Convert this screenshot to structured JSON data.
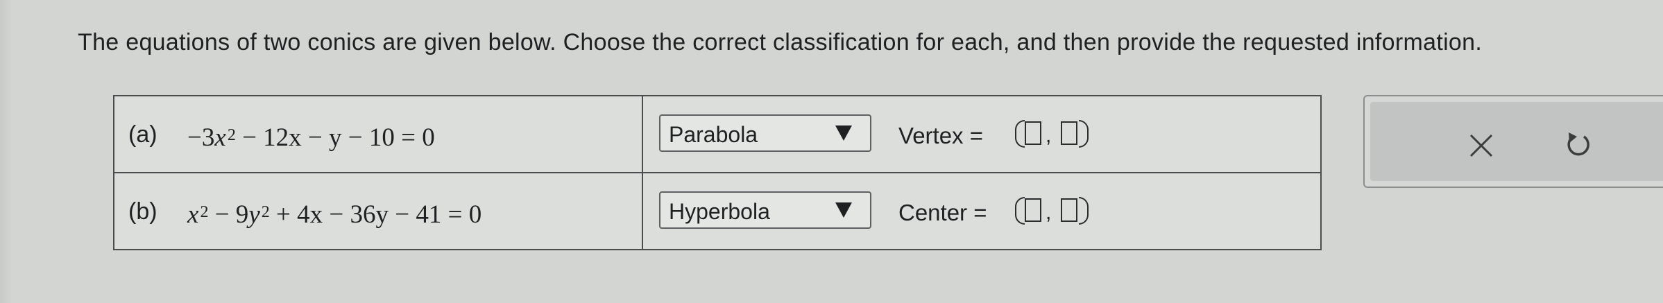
{
  "prompt": "The equations of two conics are given below. Choose the correct classification for each, and then provide the requested information.",
  "rows": [
    {
      "part": "(a)",
      "equation": {
        "lead": "−3",
        "var1": "x",
        "exp1": "2",
        "rest": " − 12x − y − 10 = 0"
      },
      "classification": "Parabola",
      "field_label": "Vertex ="
    },
    {
      "part": "(b)",
      "equation": {
        "var1": "x",
        "exp1": "2",
        "mid": " − 9",
        "var2": "y",
        "exp2": "2",
        "rest": " + 4x − 36y − 41 = 0"
      },
      "classification": "Hyperbola",
      "field_label": "Center ="
    }
  ],
  "pair_separator": ",",
  "tools": {
    "clear_icon": "close-icon",
    "undo_icon": "undo-icon"
  }
}
